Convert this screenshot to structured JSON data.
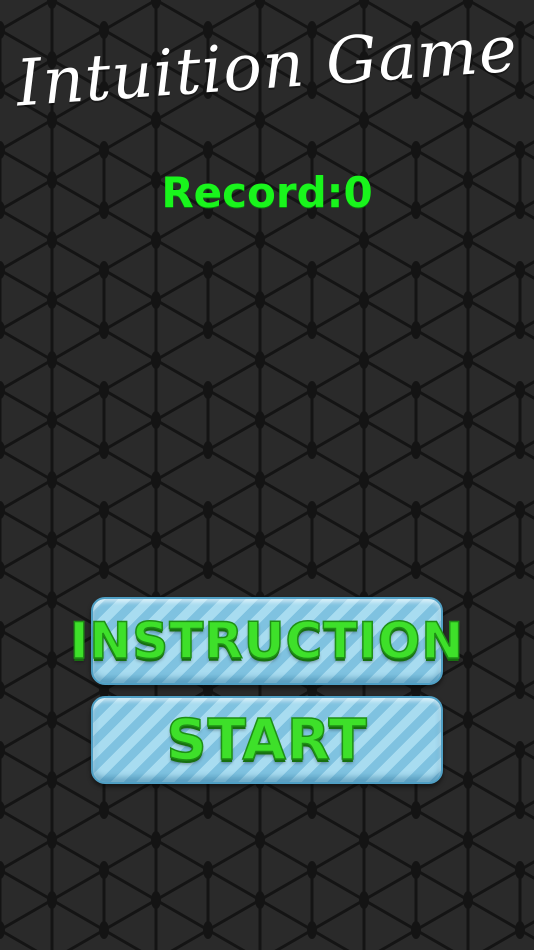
{
  "game": {
    "title": "Intuition Game",
    "record_text": "Record:0"
  },
  "menu": {
    "instruction_label": "INSTRUCTION",
    "start_label": "START"
  },
  "colors": {
    "background": "#2a2a2a",
    "record_text": "#19f51c",
    "button_face": "#a8dcf0",
    "button_label": "#3ee02a"
  }
}
